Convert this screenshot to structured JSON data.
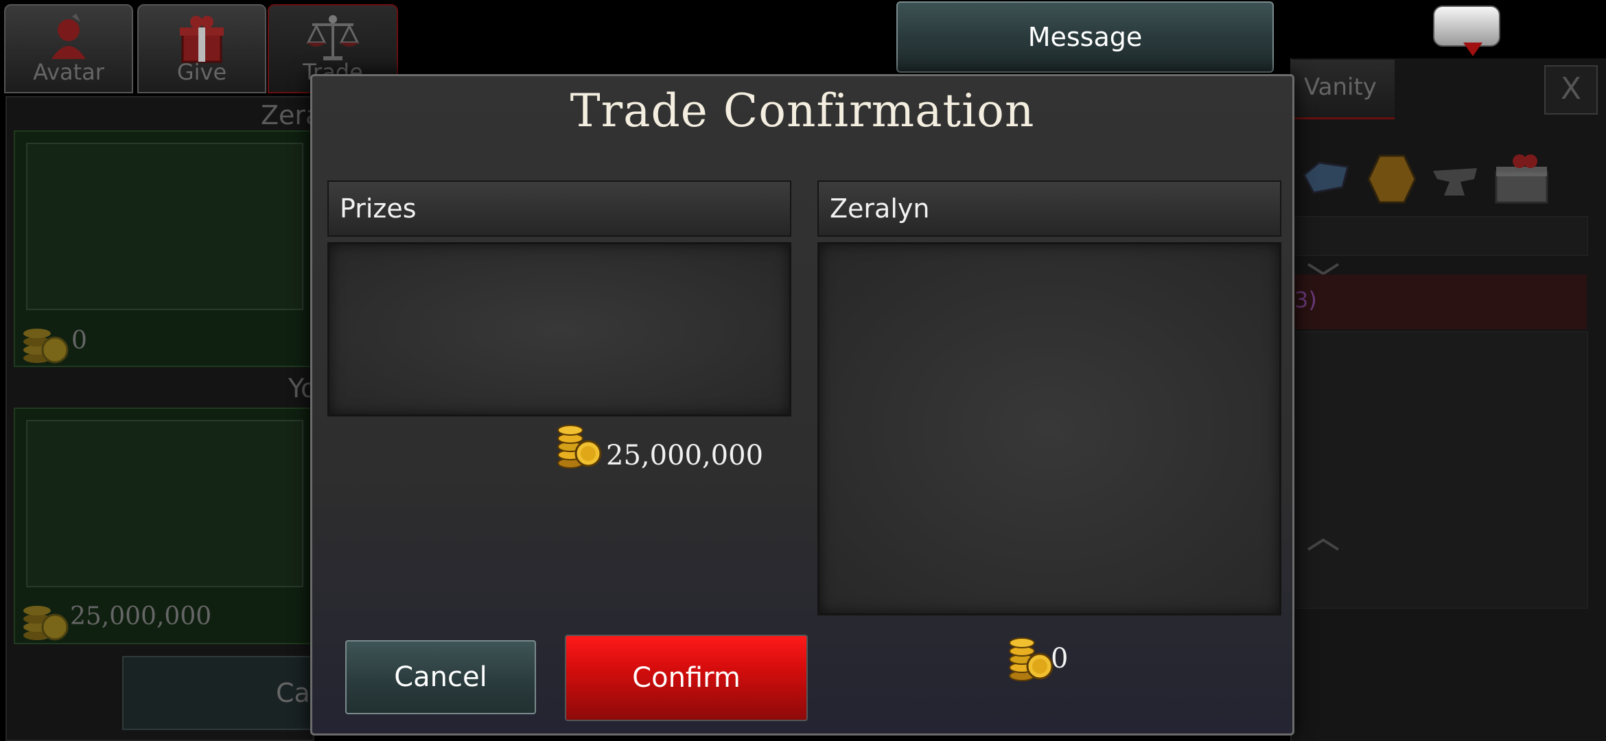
{
  "tabs": [
    {
      "label": "Avatar",
      "icon": "avatar-icon"
    },
    {
      "label": "Give",
      "icon": "gift-icon"
    },
    {
      "label": "Trade",
      "icon": "scales-icon",
      "active": true
    }
  ],
  "background": {
    "partner_label": "Zera",
    "partner_coins": "0",
    "your_label": "Yo",
    "your_coins": "25,000,000",
    "cancel_partial": "Ca",
    "vanity_tab": "Vanity",
    "close_label": "X",
    "count_partial": "3)"
  },
  "message_button": "Message",
  "modal": {
    "title": "Trade Confirmation",
    "left_header": "Prizes",
    "left_coins": "25,000,000",
    "right_header": "Zeralyn",
    "right_coins": "0",
    "cancel_label": "Cancel",
    "confirm_label": "Confirm"
  },
  "colors": {
    "confirm": "#d40c0c",
    "cancel": "#2b3c3e",
    "gold": "#e8b020"
  }
}
